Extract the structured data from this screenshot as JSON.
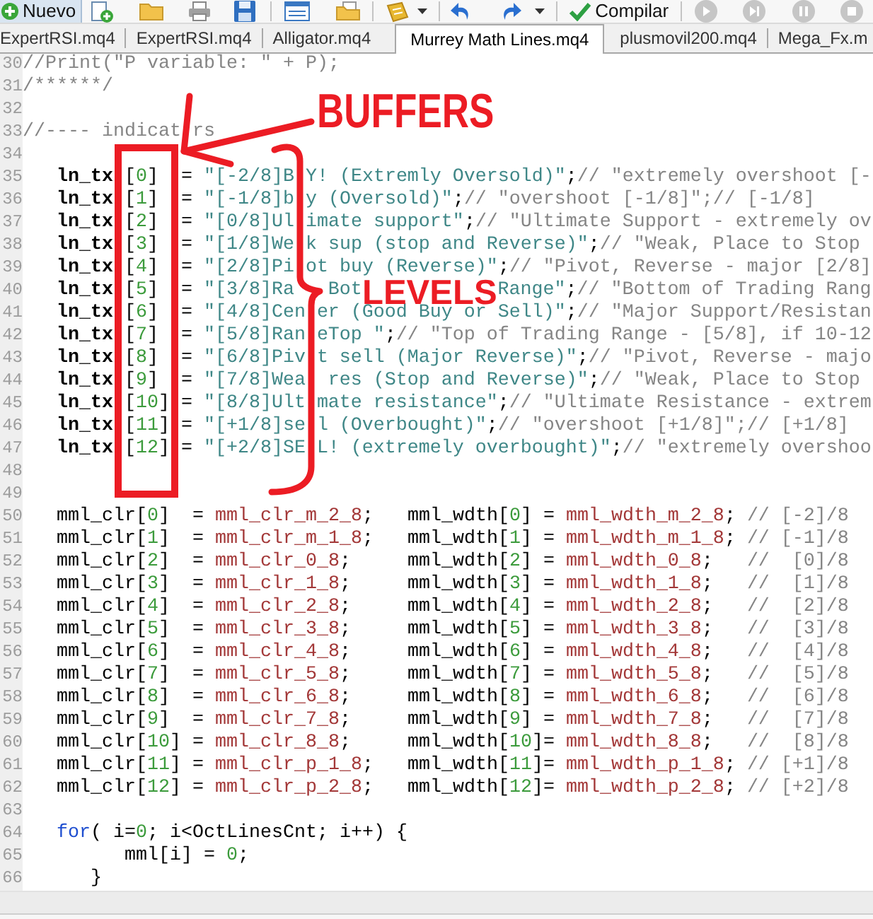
{
  "toolbar": {
    "new_label": "Nuevo",
    "compile_label": "Compilar"
  },
  "tabs": [
    {
      "label": "ExpertRSI.mq4",
      "selected": false
    },
    {
      "label": "ExpertRSI.mq4",
      "selected": false
    },
    {
      "label": "Alligator.mq4",
      "selected": false
    },
    {
      "label": "Murrey Math Lines.mq4",
      "selected": true
    },
    {
      "label": "plusmovil200.mq4",
      "selected": false
    },
    {
      "label": "Mega_Fx.m",
      "selected": false
    }
  ],
  "editor": {
    "lines": [
      {
        "number": "30",
        "tokens": [
          {
            "kind": "comment",
            "text": "//Print(\"P variable: \" + P);"
          }
        ]
      },
      {
        "number": "31",
        "tokens": [
          {
            "kind": "comment",
            "text": "/******/"
          }
        ]
      },
      {
        "number": "32"
      },
      {
        "number": "33",
        "tokens": [
          {
            "kind": "comment",
            "text": "//---- indicat"
          },
          {
            "kind": "covered"
          },
          {
            "kind": "comment",
            "text": "rs"
          }
        ]
      },
      {
        "number": "34"
      },
      {
        "number": "35",
        "tokens": [
          {
            "kind": "bold",
            "text": "   ln_tx"
          },
          {
            "kind": "covered"
          },
          {
            "kind": "plain",
            "text": "["
          },
          {
            "kind": "number",
            "text": "0"
          },
          {
            "kind": "plain",
            "text": "]  = "
          },
          {
            "kind": "string",
            "text": "\"[-2/8]B"
          },
          {
            "kind": "covered"
          },
          {
            "kind": "string",
            "text": "Y! (Extremly Oversold)\""
          },
          {
            "kind": "plain",
            "text": ";"
          },
          {
            "kind": "comment",
            "text": "// \"extremely overshoot [-"
          }
        ]
      },
      {
        "number": "36",
        "tokens": [
          {
            "kind": "bold",
            "text": "   ln_tx"
          },
          {
            "kind": "covered"
          },
          {
            "kind": "plain",
            "text": "["
          },
          {
            "kind": "number",
            "text": "1"
          },
          {
            "kind": "plain",
            "text": "]  = "
          },
          {
            "kind": "string",
            "text": "\"[-1/8]b"
          },
          {
            "kind": "covered"
          },
          {
            "kind": "string",
            "text": "y (Oversold)\""
          },
          {
            "kind": "plain",
            "text": ";"
          },
          {
            "kind": "comment",
            "text": "// \"overshoot [-1/8]\";// [-1/8]"
          }
        ]
      },
      {
        "number": "37",
        "tokens": [
          {
            "kind": "bold",
            "text": "   ln_tx"
          },
          {
            "kind": "covered"
          },
          {
            "kind": "plain",
            "text": "["
          },
          {
            "kind": "number",
            "text": "2"
          },
          {
            "kind": "plain",
            "text": "]  = "
          },
          {
            "kind": "string",
            "text": "\"[0/8]Ul"
          },
          {
            "kind": "covered"
          },
          {
            "kind": "string",
            "text": "imate support\""
          },
          {
            "kind": "plain",
            "text": ";"
          },
          {
            "kind": "comment",
            "text": "// \"Ultimate Support - extremely ov"
          }
        ]
      },
      {
        "number": "38",
        "tokens": [
          {
            "kind": "bold",
            "text": "   ln_tx"
          },
          {
            "kind": "covered"
          },
          {
            "kind": "plain",
            "text": "["
          },
          {
            "kind": "number",
            "text": "3"
          },
          {
            "kind": "plain",
            "text": "]  = "
          },
          {
            "kind": "string",
            "text": "\"[1/8]We"
          },
          {
            "kind": "covered"
          },
          {
            "kind": "string",
            "text": "k sup (stop and Reverse)\""
          },
          {
            "kind": "plain",
            "text": ";"
          },
          {
            "kind": "comment",
            "text": "// \"Weak, Place to Stop"
          }
        ]
      },
      {
        "number": "39",
        "tokens": [
          {
            "kind": "bold",
            "text": "   ln_tx"
          },
          {
            "kind": "covered"
          },
          {
            "kind": "plain",
            "text": "["
          },
          {
            "kind": "number",
            "text": "4"
          },
          {
            "kind": "plain",
            "text": "]  = "
          },
          {
            "kind": "string",
            "text": "\"[2/8]Pi"
          },
          {
            "kind": "covered"
          },
          {
            "kind": "string",
            "text": "ot buy (Reverse)\""
          },
          {
            "kind": "plain",
            "text": ";"
          },
          {
            "kind": "comment",
            "text": "// \"Pivot, Reverse - major [2/8]"
          }
        ]
      },
      {
        "number": "40",
        "tokens": [
          {
            "kind": "bold",
            "text": "   ln_tx"
          },
          {
            "kind": "covered"
          },
          {
            "kind": "plain",
            "text": "["
          },
          {
            "kind": "number",
            "text": "5"
          },
          {
            "kind": "plain",
            "text": "]  = "
          },
          {
            "kind": "string",
            "text": "\"[3/8]Ra"
          },
          {
            "kind": "covered"
          },
          {
            "kind": "covered"
          },
          {
            "kind": "covered"
          },
          {
            "kind": "string",
            "text": "Bot"
          },
          {
            "kind": "covered"
          },
          {
            "kind": "covered"
          },
          {
            "kind": "covered"
          },
          {
            "kind": "covered"
          },
          {
            "kind": "covered"
          },
          {
            "kind": "covered"
          },
          {
            "kind": "covered"
          },
          {
            "kind": "covered"
          },
          {
            "kind": "covered"
          },
          {
            "kind": "covered"
          },
          {
            "kind": "covered"
          },
          {
            "kind": "covered"
          },
          {
            "kind": "string",
            "text": "Range\""
          },
          {
            "kind": "plain",
            "text": ";"
          },
          {
            "kind": "comment",
            "text": "// \"Bottom of Trading Rang"
          }
        ]
      },
      {
        "number": "41",
        "tokens": [
          {
            "kind": "bold",
            "text": "   ln_tx"
          },
          {
            "kind": "covered"
          },
          {
            "kind": "plain",
            "text": "["
          },
          {
            "kind": "number",
            "text": "6"
          },
          {
            "kind": "plain",
            "text": "]  = "
          },
          {
            "kind": "string",
            "text": "\"[4/8]Cen"
          },
          {
            "kind": "covered"
          },
          {
            "kind": "string",
            "text": "er (Good Buy or Sell)\""
          },
          {
            "kind": "plain",
            "text": ";"
          },
          {
            "kind": "comment",
            "text": "// \"Major Support/Resistan"
          }
        ]
      },
      {
        "number": "42",
        "tokens": [
          {
            "kind": "bold",
            "text": "   ln_tx"
          },
          {
            "kind": "covered"
          },
          {
            "kind": "plain",
            "text": "["
          },
          {
            "kind": "number",
            "text": "7"
          },
          {
            "kind": "plain",
            "text": "]  = "
          },
          {
            "kind": "string",
            "text": "\"[5/8]Ran"
          },
          {
            "kind": "covered"
          },
          {
            "kind": "string",
            "text": "eTop \""
          },
          {
            "kind": "plain",
            "text": ";"
          },
          {
            "kind": "comment",
            "text": "// \"Top of Trading Range - [5/8], if 10-12"
          }
        ]
      },
      {
        "number": "43",
        "tokens": [
          {
            "kind": "bold",
            "text": "   ln_tx"
          },
          {
            "kind": "covered"
          },
          {
            "kind": "plain",
            "text": "["
          },
          {
            "kind": "number",
            "text": "8"
          },
          {
            "kind": "plain",
            "text": "]  = "
          },
          {
            "kind": "string",
            "text": "\"[6/8]Piv"
          },
          {
            "kind": "covered"
          },
          {
            "kind": "string",
            "text": "t sell (Major Reverse)\""
          },
          {
            "kind": "plain",
            "text": ";"
          },
          {
            "kind": "comment",
            "text": "// \"Pivot, Reverse - majo"
          }
        ]
      },
      {
        "number": "44",
        "tokens": [
          {
            "kind": "bold",
            "text": "   ln_tx"
          },
          {
            "kind": "covered"
          },
          {
            "kind": "plain",
            "text": "["
          },
          {
            "kind": "number",
            "text": "9"
          },
          {
            "kind": "plain",
            "text": "]  = "
          },
          {
            "kind": "string",
            "text": "\"[7/8]Wea"
          },
          {
            "kind": "covered"
          },
          {
            "kind": "string",
            "text": " res (Stop and Reverse)\""
          },
          {
            "kind": "plain",
            "text": ";"
          },
          {
            "kind": "comment",
            "text": "// \"Weak, Place to Stop"
          }
        ]
      },
      {
        "number": "45",
        "tokens": [
          {
            "kind": "bold",
            "text": "   ln_tx"
          },
          {
            "kind": "covered"
          },
          {
            "kind": "plain",
            "text": "["
          },
          {
            "kind": "number",
            "text": "10"
          },
          {
            "kind": "plain",
            "text": "] = "
          },
          {
            "kind": "string",
            "text": "\"[8/8]Ult"
          },
          {
            "kind": "covered"
          },
          {
            "kind": "string",
            "text": "mate resistance\""
          },
          {
            "kind": "plain",
            "text": ";"
          },
          {
            "kind": "comment",
            "text": "// \"Ultimate Resistance - extrem"
          }
        ]
      },
      {
        "number": "46",
        "tokens": [
          {
            "kind": "bold",
            "text": "   ln_tx"
          },
          {
            "kind": "covered"
          },
          {
            "kind": "plain",
            "text": "["
          },
          {
            "kind": "number",
            "text": "11"
          },
          {
            "kind": "plain",
            "text": "] = "
          },
          {
            "kind": "string",
            "text": "\"[+1/8]se"
          },
          {
            "kind": "covered"
          },
          {
            "kind": "string",
            "text": "l (Overbought)\""
          },
          {
            "kind": "plain",
            "text": ";"
          },
          {
            "kind": "comment",
            "text": "// \"overshoot [+1/8]\";// [+1/8]"
          }
        ]
      },
      {
        "number": "47",
        "tokens": [
          {
            "kind": "bold",
            "text": "   ln_tx"
          },
          {
            "kind": "covered"
          },
          {
            "kind": "plain",
            "text": "["
          },
          {
            "kind": "number",
            "text": "12"
          },
          {
            "kind": "plain",
            "text": "] = "
          },
          {
            "kind": "string",
            "text": "\"[+2/8]SE"
          },
          {
            "kind": "covered"
          },
          {
            "kind": "string",
            "text": "L! (extremely overbought)\""
          },
          {
            "kind": "plain",
            "text": ";"
          },
          {
            "kind": "comment",
            "text": "// \"extremely overshoo"
          }
        ]
      },
      {
        "number": "48"
      },
      {
        "number": "49"
      },
      {
        "number": "50",
        "tokens": [
          {
            "kind": "plain",
            "text": "   mml_clr["
          },
          {
            "kind": "number",
            "text": "0"
          },
          {
            "kind": "plain",
            "text": "]  = "
          },
          {
            "kind": "constant",
            "text": "mml_clr_m_2_8"
          },
          {
            "kind": "plain",
            "text": ";   mml_wdth["
          },
          {
            "kind": "number",
            "text": "0"
          },
          {
            "kind": "plain",
            "text": "] = "
          },
          {
            "kind": "constant",
            "text": "mml_wdth_m_2_8"
          },
          {
            "kind": "plain",
            "text": "; "
          },
          {
            "kind": "comment",
            "text": "// [-2]/8"
          }
        ]
      },
      {
        "number": "51",
        "tokens": [
          {
            "kind": "plain",
            "text": "   mml_clr["
          },
          {
            "kind": "number",
            "text": "1"
          },
          {
            "kind": "plain",
            "text": "]  = "
          },
          {
            "kind": "constant",
            "text": "mml_clr_m_1_8"
          },
          {
            "kind": "plain",
            "text": ";   mml_wdth["
          },
          {
            "kind": "number",
            "text": "1"
          },
          {
            "kind": "plain",
            "text": "] = "
          },
          {
            "kind": "constant",
            "text": "mml_wdth_m_1_8"
          },
          {
            "kind": "plain",
            "text": "; "
          },
          {
            "kind": "comment",
            "text": "// [-1]/8"
          }
        ]
      },
      {
        "number": "52",
        "tokens": [
          {
            "kind": "plain",
            "text": "   mml_clr["
          },
          {
            "kind": "number",
            "text": "2"
          },
          {
            "kind": "plain",
            "text": "]  = "
          },
          {
            "kind": "constant",
            "text": "mml_clr_0_8"
          },
          {
            "kind": "plain",
            "text": ";     mml_wdth["
          },
          {
            "kind": "number",
            "text": "2"
          },
          {
            "kind": "plain",
            "text": "] = "
          },
          {
            "kind": "constant",
            "text": "mml_wdth_0_8"
          },
          {
            "kind": "plain",
            "text": ";   "
          },
          {
            "kind": "comment",
            "text": "//  [0]/8"
          }
        ]
      },
      {
        "number": "53",
        "tokens": [
          {
            "kind": "plain",
            "text": "   mml_clr["
          },
          {
            "kind": "number",
            "text": "3"
          },
          {
            "kind": "plain",
            "text": "]  = "
          },
          {
            "kind": "constant",
            "text": "mml_clr_1_8"
          },
          {
            "kind": "plain",
            "text": ";     mml_wdth["
          },
          {
            "kind": "number",
            "text": "3"
          },
          {
            "kind": "plain",
            "text": "] = "
          },
          {
            "kind": "constant",
            "text": "mml_wdth_1_8"
          },
          {
            "kind": "plain",
            "text": ";   "
          },
          {
            "kind": "comment",
            "text": "//  [1]/8"
          }
        ]
      },
      {
        "number": "54",
        "tokens": [
          {
            "kind": "plain",
            "text": "   mml_clr["
          },
          {
            "kind": "number",
            "text": "4"
          },
          {
            "kind": "plain",
            "text": "]  = "
          },
          {
            "kind": "constant",
            "text": "mml_clr_2_8"
          },
          {
            "kind": "plain",
            "text": ";     mml_wdth["
          },
          {
            "kind": "number",
            "text": "4"
          },
          {
            "kind": "plain",
            "text": "] = "
          },
          {
            "kind": "constant",
            "text": "mml_wdth_2_8"
          },
          {
            "kind": "plain",
            "text": ";   "
          },
          {
            "kind": "comment",
            "text": "//  [2]/8"
          }
        ]
      },
      {
        "number": "55",
        "tokens": [
          {
            "kind": "plain",
            "text": "   mml_clr["
          },
          {
            "kind": "number",
            "text": "5"
          },
          {
            "kind": "plain",
            "text": "]  = "
          },
          {
            "kind": "constant",
            "text": "mml_clr_3_8"
          },
          {
            "kind": "plain",
            "text": ";     mml_wdth["
          },
          {
            "kind": "number",
            "text": "5"
          },
          {
            "kind": "plain",
            "text": "] = "
          },
          {
            "kind": "constant",
            "text": "mml_wdth_3_8"
          },
          {
            "kind": "plain",
            "text": ";   "
          },
          {
            "kind": "comment",
            "text": "//  [3]/8"
          }
        ]
      },
      {
        "number": "56",
        "tokens": [
          {
            "kind": "plain",
            "text": "   mml_clr["
          },
          {
            "kind": "number",
            "text": "6"
          },
          {
            "kind": "plain",
            "text": "]  = "
          },
          {
            "kind": "constant",
            "text": "mml_clr_4_8"
          },
          {
            "kind": "plain",
            "text": ";     mml_wdth["
          },
          {
            "kind": "number",
            "text": "6"
          },
          {
            "kind": "plain",
            "text": "] = "
          },
          {
            "kind": "constant",
            "text": "mml_wdth_4_8"
          },
          {
            "kind": "plain",
            "text": ";   "
          },
          {
            "kind": "comment",
            "text": "//  [4]/8"
          }
        ]
      },
      {
        "number": "57",
        "tokens": [
          {
            "kind": "plain",
            "text": "   mml_clr["
          },
          {
            "kind": "number",
            "text": "7"
          },
          {
            "kind": "plain",
            "text": "]  = "
          },
          {
            "kind": "constant",
            "text": "mml_clr_5_8"
          },
          {
            "kind": "plain",
            "text": ";     mml_wdth["
          },
          {
            "kind": "number",
            "text": "7"
          },
          {
            "kind": "plain",
            "text": "] = "
          },
          {
            "kind": "constant",
            "text": "mml_wdth_5_8"
          },
          {
            "kind": "plain",
            "text": ";   "
          },
          {
            "kind": "comment",
            "text": "//  [5]/8"
          }
        ]
      },
      {
        "number": "58",
        "tokens": [
          {
            "kind": "plain",
            "text": "   mml_clr["
          },
          {
            "kind": "number",
            "text": "8"
          },
          {
            "kind": "plain",
            "text": "]  = "
          },
          {
            "kind": "constant",
            "text": "mml_clr_6_8"
          },
          {
            "kind": "plain",
            "text": ";     mml_wdth["
          },
          {
            "kind": "number",
            "text": "8"
          },
          {
            "kind": "plain",
            "text": "] = "
          },
          {
            "kind": "constant",
            "text": "mml_wdth_6_8"
          },
          {
            "kind": "plain",
            "text": ";   "
          },
          {
            "kind": "comment",
            "text": "//  [6]/8"
          }
        ]
      },
      {
        "number": "59",
        "tokens": [
          {
            "kind": "plain",
            "text": "   mml_clr["
          },
          {
            "kind": "number",
            "text": "9"
          },
          {
            "kind": "plain",
            "text": "]  = "
          },
          {
            "kind": "constant",
            "text": "mml_clr_7_8"
          },
          {
            "kind": "plain",
            "text": ";     mml_wdth["
          },
          {
            "kind": "number",
            "text": "9"
          },
          {
            "kind": "plain",
            "text": "] = "
          },
          {
            "kind": "constant",
            "text": "mml_wdth_7_8"
          },
          {
            "kind": "plain",
            "text": ";   "
          },
          {
            "kind": "comment",
            "text": "//  [7]/8"
          }
        ]
      },
      {
        "number": "60",
        "tokens": [
          {
            "kind": "plain",
            "text": "   mml_clr["
          },
          {
            "kind": "number",
            "text": "10"
          },
          {
            "kind": "plain",
            "text": "] = "
          },
          {
            "kind": "constant",
            "text": "mml_clr_8_8"
          },
          {
            "kind": "plain",
            "text": ";     mml_wdth["
          },
          {
            "kind": "number",
            "text": "10"
          },
          {
            "kind": "plain",
            "text": "]= "
          },
          {
            "kind": "constant",
            "text": "mml_wdth_8_8"
          },
          {
            "kind": "plain",
            "text": ";   "
          },
          {
            "kind": "comment",
            "text": "//  [8]/8"
          }
        ]
      },
      {
        "number": "61",
        "tokens": [
          {
            "kind": "plain",
            "text": "   mml_clr["
          },
          {
            "kind": "number",
            "text": "11"
          },
          {
            "kind": "plain",
            "text": "] = "
          },
          {
            "kind": "constant",
            "text": "mml_clr_p_1_8"
          },
          {
            "kind": "plain",
            "text": ";   mml_wdth["
          },
          {
            "kind": "number",
            "text": "11"
          },
          {
            "kind": "plain",
            "text": "]= "
          },
          {
            "kind": "constant",
            "text": "mml_wdth_p_1_8"
          },
          {
            "kind": "plain",
            "text": "; "
          },
          {
            "kind": "comment",
            "text": "// [+1]/8"
          }
        ]
      },
      {
        "number": "62",
        "tokens": [
          {
            "kind": "plain",
            "text": "   mml_clr["
          },
          {
            "kind": "number",
            "text": "12"
          },
          {
            "kind": "plain",
            "text": "] = "
          },
          {
            "kind": "constant",
            "text": "mml_clr_p_2_8"
          },
          {
            "kind": "plain",
            "text": ";   mml_wdth["
          },
          {
            "kind": "number",
            "text": "12"
          },
          {
            "kind": "plain",
            "text": "]= "
          },
          {
            "kind": "constant",
            "text": "mml_wdth_p_2_8"
          },
          {
            "kind": "plain",
            "text": "; "
          },
          {
            "kind": "comment",
            "text": "// [+2]/8"
          }
        ]
      },
      {
        "number": "63"
      },
      {
        "number": "64",
        "tokens": [
          {
            "kind": "keyword",
            "text": "   for"
          },
          {
            "kind": "plain",
            "text": "( i="
          },
          {
            "kind": "number",
            "text": "0"
          },
          {
            "kind": "plain",
            "text": "; i<OctLinesCnt; i++) {"
          }
        ]
      },
      {
        "number": "65",
        "tokens": [
          {
            "kind": "plain",
            "text": "         mml[i] = "
          },
          {
            "kind": "number",
            "text": "0"
          },
          {
            "kind": "plain",
            "text": ";"
          }
        ]
      },
      {
        "number": "66",
        "tokens": [
          {
            "kind": "plain",
            "text": "      }"
          }
        ]
      }
    ]
  },
  "annotations": [
    {
      "text": "BUFFERS"
    },
    {
      "text": "LEVELS"
    }
  ]
}
